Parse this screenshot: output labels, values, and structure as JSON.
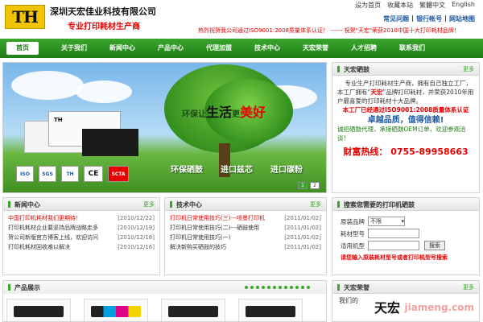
{
  "header": {
    "logo_text": "TH",
    "company_name": "深圳天宏佳业科技有限公司",
    "slogan": "专业打印耗材生产商",
    "top_links": [
      "设为首页",
      "收藏本站",
      "繁體中文",
      "English"
    ],
    "quick_links": [
      "常见问题",
      "银行帐号",
      "网站地图"
    ],
    "marquee": "热烈祝贺我公司通过ISO9001:2008质量体系认证！ ------ 祝贺\"天宏\"荣获2010中国十大打印耗材品牌！"
  },
  "nav": {
    "items": [
      "首页",
      "关于我们",
      "新闻中心",
      "产品中心",
      "代理加盟",
      "技术中心",
      "天宏荣誉",
      "人才招聘",
      "联系我们"
    ],
    "active_index": 0
  },
  "banner": {
    "slogan_prefix": "环保",
    "slogan_mid1": "让",
    "slogan_big1": "生活",
    "slogan_mid2": "更",
    "slogan_big2": "美好",
    "product_label": "TH",
    "certs": [
      "ISO",
      "SGS",
      "TH",
      "CE",
      "SCTA"
    ],
    "tags": [
      "环保硒鼓",
      "进口兹芯",
      "进口碳粉"
    ],
    "slider_pages": [
      "1",
      "2"
    ],
    "active_page": 0
  },
  "about": {
    "title": "天宏硒鼓",
    "more": "更多",
    "line1": "专业生产打印耗材生产商，拥有自己独立工厂，本工厂拥有“",
    "brand": "天宏",
    "line2": "”品牌打印耗材，并荣获2010年用户最喜爱的打印耗材十大品牌。",
    "iso_note": "本工厂已经通过ISO9001:2008质量体系认证",
    "quality": "卓越品质，值得信赖!",
    "invite": "诚招硒鼓代理，承接硒鼓OEM订单，欢迎参观洽谈！",
    "phone": "财富热线： 0755-89958663"
  },
  "news": {
    "title": "新闻中心",
    "more": "更多",
    "items": [
      {
        "title": "中国打印机耗材我们更期待！",
        "date": "[2010/12/22]",
        "hot": true
      },
      {
        "title": "打印机耗材企业要坚持品牌战略走多",
        "date": "[2010/12/19]",
        "hot": false
      },
      {
        "title": "贺公司新版官方博客上线，欢迎访问",
        "date": "[2010/12/18]",
        "hot": false
      },
      {
        "title": "打印机耗材回收难以解决",
        "date": "[2010/12/16]",
        "hot": false
      }
    ]
  },
  "tech": {
    "title": "技术中心",
    "more": "更多",
    "items": [
      {
        "title": "打印机日常使用技巧(三)---喷墨打印机",
        "date": "[2011/01/02]",
        "hot": true
      },
      {
        "title": "打印机日常使用技巧(二)---硒鼓使用",
        "date": "[2011/01/02]",
        "hot": false
      },
      {
        "title": "打印机日常使用技巧(一)",
        "date": "[2011/01/02]",
        "hot": false
      },
      {
        "title": "解决新购买硒鼓的技巧",
        "date": "[2011/01/02]",
        "hot": false
      }
    ]
  },
  "search": {
    "title": "搜索您需要的打印机硒鼓",
    "brand_label": "原装品牌",
    "brand_value": "不限",
    "model_label": "耗材型号",
    "model_value": "",
    "printer_label": "适用机型",
    "printer_value": "",
    "button": "搜索",
    "note": "请您输入原装耗材型号或者打印机型号搜索"
  },
  "products": {
    "title": "产品展示",
    "dot_count": 12
  },
  "honor": {
    "title": "天宏荣誉",
    "more": "更多",
    "side_text": "我们的",
    "big_text": "天宏",
    "watermark": "jiameng.com"
  },
  "colors": {
    "green": "#1f7d16",
    "red": "#e60000",
    "blue": "#1d5aa6",
    "logo_yellow": "#f1c400"
  }
}
